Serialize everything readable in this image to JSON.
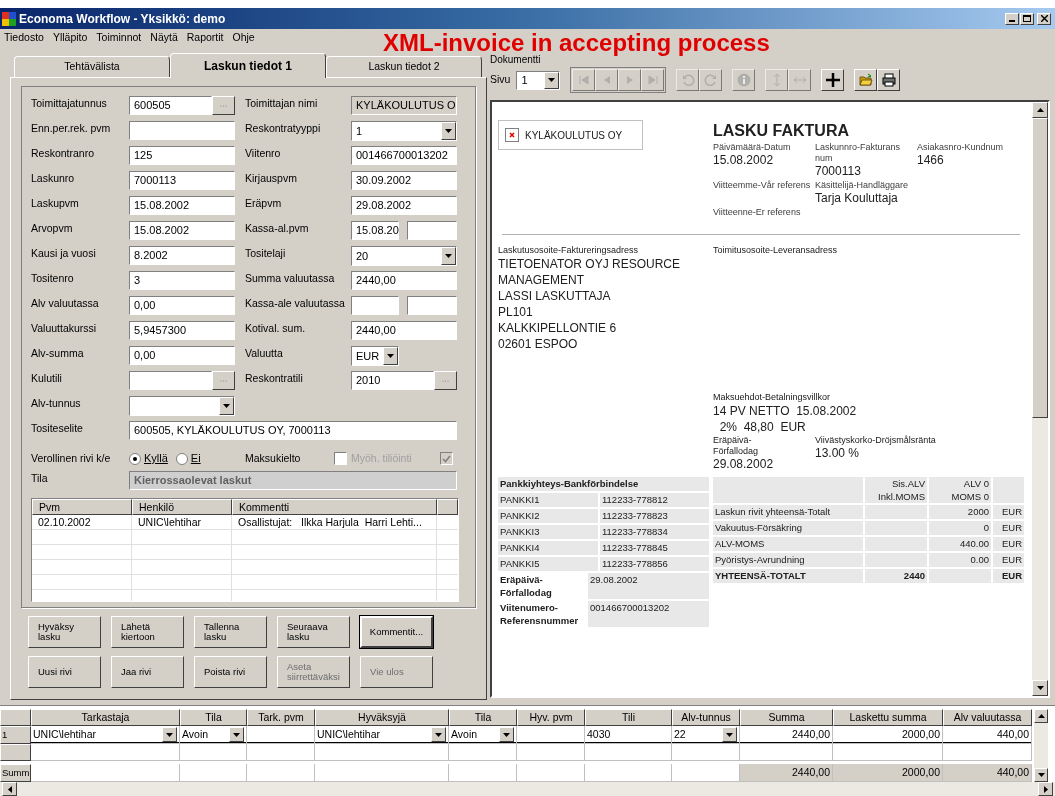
{
  "window": {
    "title": "Economa Workflow - Yksikkö: demo"
  },
  "menu": [
    "Tiedosto",
    "Ylläpito",
    "Toiminnot",
    "Näytä",
    "Raportit",
    "Ohje"
  ],
  "banner": "XML-invoice in accepting process",
  "tabs": [
    {
      "label": "Tehtävälista",
      "selected": false
    },
    {
      "label": "Laskun tiedot 1",
      "selected": true
    },
    {
      "label": "Laskun tiedot 2",
      "selected": false
    }
  ],
  "form": {
    "rows": [
      {
        "left": {
          "label": "Toimittajatunnus",
          "kind": "lookup",
          "value": "600505"
        },
        "right": {
          "label": "Toimittajan nimi",
          "kind": "readonly",
          "value": "KYLÄKOULUTUS O"
        }
      },
      {
        "left": {
          "label": "Enn.per.rek. pvm",
          "kind": "text"
        },
        "right": {
          "label": "Reskontratyyppi",
          "kind": "combo",
          "value": "1"
        }
      },
      {
        "left": {
          "label": "Reskontranro",
          "kind": "text",
          "value": "125"
        },
        "right": {
          "label": "Viitenro",
          "kind": "text",
          "value": "001466700013202"
        }
      },
      {
        "left": {
          "label": "Laskunro",
          "kind": "text",
          "value": "7000113"
        },
        "right": {
          "label": "Kirjauspvm",
          "kind": "text",
          "value": "30.09.2002"
        }
      },
      {
        "left": {
          "label": "Laskupvm",
          "kind": "text",
          "value": "15.08.2002"
        },
        "right": {
          "label": "Eräpvm",
          "kind": "text",
          "value": "29.08.2002"
        }
      },
      {
        "left": {
          "label": "Arvopvm",
          "kind": "text",
          "value": "15.08.2002"
        },
        "right": {
          "label": "Kassa-al.pvm",
          "kind": "split",
          "value": "15.08.20"
        }
      },
      {
        "left": {
          "label": "Kausi ja vuosi",
          "kind": "text",
          "value": "8.2002"
        },
        "right": {
          "label": "Tositelaji",
          "kind": "combo",
          "value": "20"
        }
      },
      {
        "left": {
          "label": "Tositenro",
          "kind": "text",
          "value": "3"
        },
        "right": {
          "label": "Summa valuutassa",
          "kind": "text",
          "value": "2440,00"
        }
      },
      {
        "left": {
          "label": "Alv valuutassa",
          "kind": "text",
          "value": "0,00"
        },
        "right": {
          "label": "Kassa-ale valuutassa",
          "kind": "split"
        }
      },
      {
        "left": {
          "label": "Valuuttakurssi",
          "kind": "text",
          "value": "5,9457300"
        },
        "right": {
          "label": "Kotival. sum.",
          "kind": "text",
          "value": "2440,00"
        }
      },
      {
        "left": {
          "label": "Alv-summa",
          "kind": "text",
          "value": "0,00"
        },
        "right": {
          "label": "Valuutta",
          "kind": "small-combo",
          "value": "EUR"
        }
      },
      {
        "left": {
          "label": "Kulutili",
          "kind": "lookup"
        },
        "right": {
          "label": "Reskontratili",
          "kind": "lookup",
          "value": "2010"
        }
      },
      {
        "left": {
          "label": "Alv-tunnus",
          "kind": "combo"
        }
      }
    ],
    "description": {
      "label": "Tositeselite",
      "value": "600505, KYLÄKOULUTUS OY, 7000113"
    },
    "taxable": {
      "label": "Verollinen rivi k/e",
      "options": [
        {
          "label": "Kyllä",
          "selected": true
        },
        {
          "label": "Ei",
          "selected": false
        }
      ]
    },
    "checks": [
      {
        "label": "Maksukielto",
        "checked": false,
        "disabled": false
      },
      {
        "label": "Myöh. tiliöinti",
        "checked": true,
        "disabled": true
      }
    ],
    "status": {
      "label": "Tila",
      "value": "Kierrossaolevat laskut"
    }
  },
  "comments": {
    "columns": [
      "Pvm",
      "Henkilö",
      "Kommentti"
    ],
    "rows": [
      [
        "02.10.2002",
        "UNIC\\lehtihar",
        "Osallistujat:   Ilkka Harjula  Harri Lehti..."
      ]
    ]
  },
  "actions": [
    [
      {
        "label": "Hyväksy lasku",
        "disabled": false,
        "default": false
      },
      {
        "label": "Lähetä kiertoon",
        "disabled": false,
        "default": false
      },
      {
        "label": "Tallenna lasku",
        "disabled": false,
        "default": false
      },
      {
        "label": "Seuraava lasku",
        "disabled": false,
        "default": false
      },
      {
        "label": "Kommentit...",
        "disabled": false,
        "default": true
      }
    ],
    [
      {
        "label": "Uusi rivi",
        "disabled": false,
        "default": false
      },
      {
        "label": "Jaa rivi",
        "disabled": false,
        "default": false
      },
      {
        "label": "Poista rivi",
        "disabled": false,
        "default": false
      },
      {
        "label": "Aseta siirrettäväksi",
        "disabled": true,
        "default": false
      },
      {
        "label": "Vie ulos",
        "disabled": true,
        "default": false
      }
    ]
  ],
  "document": {
    "group_label": "Dokumentti",
    "page_label": "Sivu",
    "page": "1",
    "toolbar": [
      [
        {
          "kind": "first",
          "disabled": true
        },
        {
          "kind": "prev",
          "disabled": true
        },
        {
          "kind": "next",
          "disabled": true
        },
        {
          "kind": "last",
          "disabled": true
        }
      ],
      [
        {
          "kind": "undo",
          "disabled": true
        },
        {
          "kind": "redo",
          "disabled": true
        }
      ],
      [
        {
          "kind": "info",
          "disabled": true
        }
      ],
      [
        {
          "kind": "fit-height",
          "disabled": true
        },
        {
          "kind": "fit-width",
          "disabled": true
        }
      ],
      [
        {
          "kind": "cross",
          "disabled": false
        }
      ],
      [
        {
          "kind": "open",
          "disabled": false
        },
        {
          "kind": "print",
          "disabled": false
        }
      ]
    ],
    "sender": "KYLÄKOULUTUS OY",
    "title": "LASKU FAKTURA",
    "header_fields": [
      [
        {
          "label": "Päivämäärä-Datum",
          "value": "15.08.2002"
        },
        {
          "label": "Laskunnro-Fakturans num",
          "value": "7000113"
        },
        {
          "label": "Asiakasnro-Kundnum",
          "value": "1466"
        }
      ],
      [
        {
          "label": "Viitteemme-Vår referens"
        },
        {
          "label": "Käsittelijä-Handläggare",
          "value": "Tarja Kouluttaja"
        }
      ],
      [
        {
          "label": "Viitteenne-Er referens"
        }
      ]
    ],
    "billing": {
      "label": "Laskutusosoite-Faktureringsadress",
      "lines": [
        "TIETOENATOR OYJ RESOURCE",
        "MANAGEMENT",
        "LASSI LASKUTTAJA",
        "PL101",
        "KALKKIPELLONTIE 6",
        "02601 ESPOO"
      ]
    },
    "delivery": {
      "label": "Toimitusosoite-Leveransadress"
    },
    "payment": {
      "label": "Maksuehdot-Betalningsvillkor",
      "lines": [
        "14 PV NETTO  15.08.2002",
        "  2%  48,80  EUR"
      ],
      "due_label": "Eräpäivä-Förfallodag",
      "due": "29.08.2002",
      "interest_label": "Viivästyskorko-Dröjsmålsränta",
      "interest": "13.00 %"
    },
    "bank": {
      "title": "Pankkiyhteys-Bankförbindelse",
      "rows": [
        [
          "PANKKI1",
          "112233-778812"
        ],
        [
          "PANKKI2",
          "112233-778823"
        ],
        [
          "PANKKI3",
          "112233-778834"
        ],
        [
          "PANKKI4",
          "112233-778845"
        ],
        [
          "PANKKI5",
          "112233-778856"
        ]
      ],
      "extra": [
        {
          "label": "Eräpäivä-Förfallodag",
          "value": "29.08.2002"
        },
        {
          "label": "Viitenumero-Referensnummer",
          "value": "001466700013202"
        }
      ]
    },
    "totals": {
      "columns": [
        [
          "Sis.ALV",
          "Inkl.MOMS"
        ],
        [
          "ALV 0",
          "MOMS 0"
        ]
      ],
      "rows": [
        {
          "label": "Laskun rivit yhteensä-Totalt",
          "zero": "2000",
          "currency": "EUR",
          "bold": false
        },
        {
          "label": "Vakuutus-Försäkring",
          "zero": "0",
          "currency": "EUR",
          "bold": false
        },
        {
          "label": "ALV-MOMS",
          "zero": "440.00",
          "currency": "EUR",
          "bold": false
        },
        {
          "label": "Pyöristys-Avrundning",
          "zero": "0.00",
          "currency": "EUR",
          "bold": false
        },
        {
          "label": "YHTEENSÄ-TOTALT",
          "incl": "2440",
          "currency": "EUR",
          "bold": true
        }
      ]
    }
  },
  "grid": {
    "columns": [
      {
        "label": "Tarkastaja",
        "kind": "combo"
      },
      {
        "label": "Tila",
        "kind": "combo"
      },
      {
        "label": "Tark. pvm",
        "kind": "text"
      },
      {
        "label": "Hyväksyjä",
        "kind": "combo"
      },
      {
        "label": "Tila",
        "kind": "combo"
      },
      {
        "label": "Hyv. pvm",
        "kind": "text"
      },
      {
        "label": "Tili",
        "kind": "text"
      },
      {
        "label": "Alv-tunnus",
        "kind": "combo"
      },
      {
        "label": "Summa",
        "kind": "number"
      },
      {
        "label": "Laskettu summa",
        "kind": "number"
      },
      {
        "label": "Alv valuutassa",
        "kind": "number"
      }
    ],
    "rows": [
      {
        "header": "1",
        "kind": "data",
        "cells": [
          "UNIC\\lehtihar",
          "Avoin",
          null,
          "UNIC\\lehtihar",
          "Avoin",
          null,
          "4030",
          "22",
          "2440,00",
          "2000,00",
          "440,00"
        ]
      },
      {
        "kind": "new",
        "cells": [
          null,
          null,
          null,
          null,
          null,
          null,
          null,
          null,
          null,
          null,
          null
        ]
      },
      {
        "header": "Summ",
        "kind": "sum",
        "cells": [
          null,
          null,
          null,
          null,
          null,
          null,
          null,
          null,
          "2440,00",
          "2000,00",
          "440,00"
        ]
      }
    ]
  }
}
